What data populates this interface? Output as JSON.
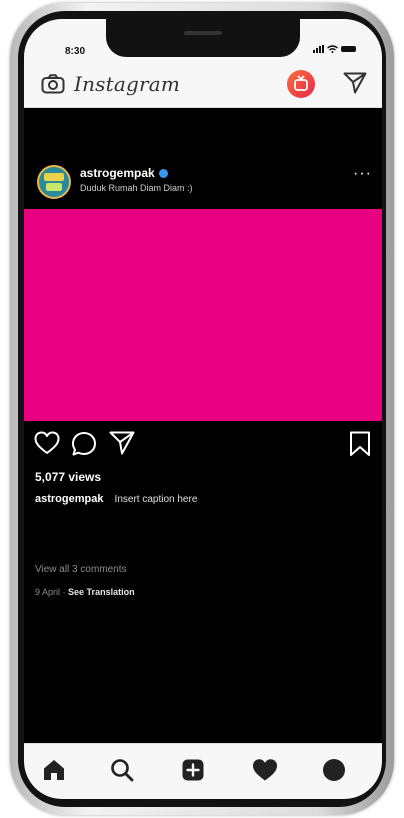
{
  "status_bar": {
    "time": "8:30"
  },
  "top_nav": {
    "brand": "Instagram"
  },
  "post": {
    "username": "astrogempak",
    "location": "Duduk Rumah Diam Diam :)",
    "views": "5,077 views",
    "caption_user": "astrogempak",
    "caption_text": "Insert caption here",
    "comments_link": "View all 3 comments",
    "date": "9 April",
    "separator": "·",
    "see_translation": "See Translation",
    "media_color": "#e80080"
  },
  "icons": {
    "top": [
      "camera-icon",
      "igtv-icon",
      "direct-send-icon"
    ],
    "post_header": [
      "verified-badge-icon",
      "more-options-icon"
    ],
    "actions": [
      "heart-icon",
      "comment-icon",
      "share-icon",
      "bookmark-icon"
    ],
    "bottom_nav": [
      "home-icon",
      "search-icon",
      "new-post-icon",
      "activity-heart-icon",
      "profile-icon"
    ]
  },
  "colors": {
    "accent": "#3897f0",
    "igtv_gradient": [
      "#ff6d3a",
      "#e6284d"
    ],
    "screen_background": "#000000"
  }
}
